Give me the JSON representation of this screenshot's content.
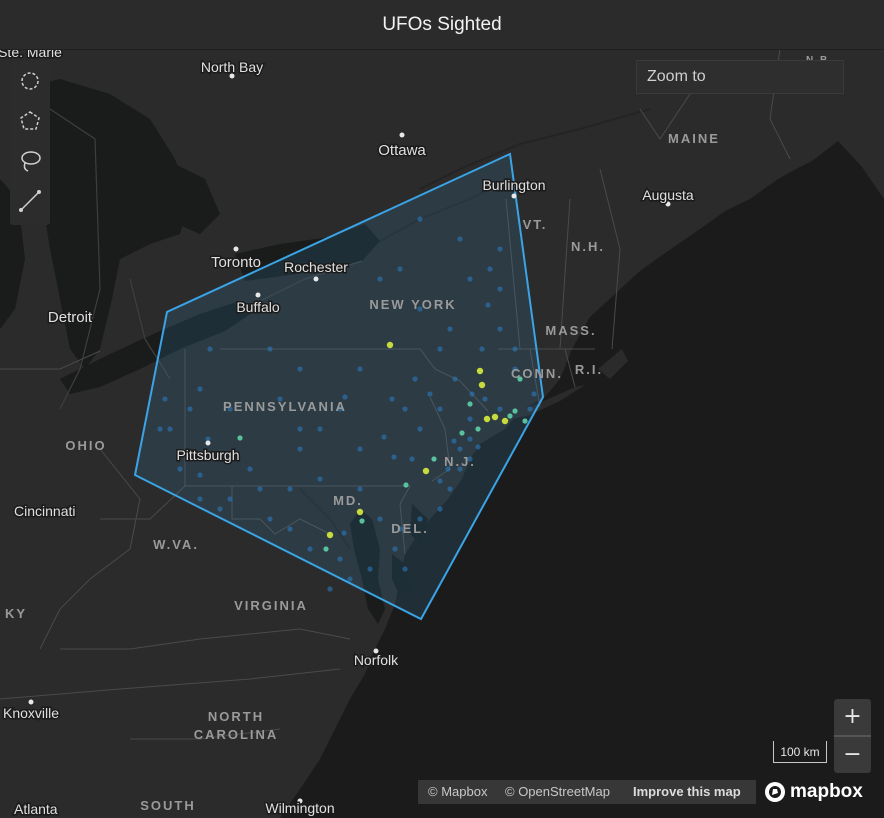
{
  "window": {
    "title": "UFOs Sighted"
  },
  "search": {
    "placeholder": "Zoom to"
  },
  "draw_tools": [
    "circle",
    "polygon",
    "lasso",
    "line"
  ],
  "zoom": {
    "in_label": "+",
    "out_label": "−"
  },
  "scale_bar": {
    "label": "100 km"
  },
  "attribution": {
    "mapbox": "© Mapbox",
    "osm": "© OpenStreetMap",
    "improve": "Improve this map"
  },
  "logo": {
    "text": "mapbox"
  },
  "colors": {
    "background": "#1b1b1b",
    "land": "#2b2b2b",
    "water": "#1a1b1b",
    "selection_stroke": "#3aa4e6",
    "selection_fill": "#3aa4e6",
    "point_low": "#2b7fc8",
    "point_high": "#d8ee3c"
  },
  "map_labels": {
    "cities": [
      {
        "name": "Ste. Marie"
      },
      {
        "name": "North Bay"
      },
      {
        "name": "Ottawa"
      },
      {
        "name": "Burlington"
      },
      {
        "name": "Augusta"
      },
      {
        "name": "Toronto"
      },
      {
        "name": "Rochester"
      },
      {
        "name": "Buffalo"
      },
      {
        "name": "Detroit"
      },
      {
        "name": "Pittsburgh"
      },
      {
        "name": "Cincinnati"
      },
      {
        "name": "Norfolk"
      },
      {
        "name": "Knoxville"
      },
      {
        "name": "Atlanta"
      },
      {
        "name": "Wilmington"
      }
    ],
    "states": [
      {
        "name": "MAINE"
      },
      {
        "name": "N.B."
      },
      {
        "name": "VT."
      },
      {
        "name": "N.H."
      },
      {
        "name": "MASS."
      },
      {
        "name": "R.I."
      },
      {
        "name": "CONN."
      },
      {
        "name": "NEW YORK"
      },
      {
        "name": "PENNSYLVANIA"
      },
      {
        "name": "N.J."
      },
      {
        "name": "MD."
      },
      {
        "name": "DEL."
      },
      {
        "name": "OHIO"
      },
      {
        "name": "W.VA."
      },
      {
        "name": "VIRGINIA"
      },
      {
        "name": "KY"
      },
      {
        "name": "NORTH CAROLINA"
      },
      {
        "name": "SOUTH"
      }
    ]
  }
}
